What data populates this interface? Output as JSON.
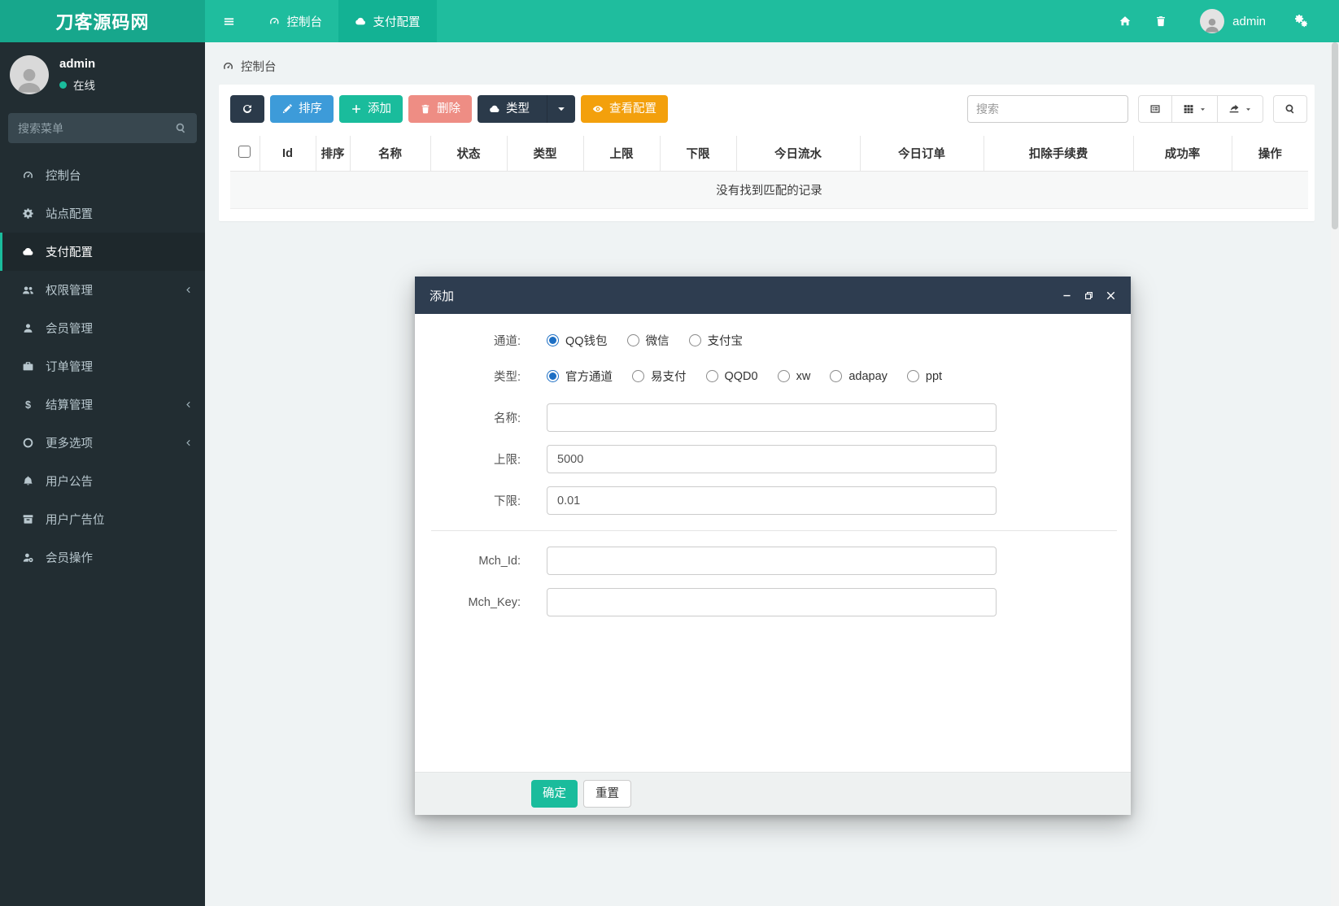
{
  "colors": {
    "teal": "#1fbd9e",
    "teal_logo": "#17a78c",
    "teal_active": "#13b294",
    "green": "#1abc9c",
    "blue": "#3d9bd9",
    "red": "#ee8d84",
    "orange": "#f3a00c",
    "dark": "#2b3a4a",
    "sidebar_bg": "#222d32",
    "sidebar_active_bg": "#1e282c",
    "radio_blue": "#1d6fc4",
    "page_bg": "#eff3f4"
  },
  "navbar": {
    "brand": "刀客源码网",
    "tab_dashboard": "控制台",
    "tab_payment": "支付配置",
    "username": "admin"
  },
  "sidebar": {
    "user_name": "admin",
    "user_status": "在线",
    "search_placeholder": "搜索菜单",
    "items": [
      {
        "label": "控制台",
        "icon": "gauge"
      },
      {
        "label": "站点配置",
        "icon": "gear"
      },
      {
        "label": "支付配置",
        "icon": "cloud",
        "active": true
      },
      {
        "label": "权限管理",
        "icon": "users",
        "chevron": true
      },
      {
        "label": "会员管理",
        "icon": "user"
      },
      {
        "label": "订单管理",
        "icon": "briefcase"
      },
      {
        "label": "结算管理",
        "icon": "dollar",
        "chevron": true
      },
      {
        "label": "更多选项",
        "icon": "circle-o",
        "chevron": true
      },
      {
        "label": "用户公告",
        "icon": "bell"
      },
      {
        "label": "用户广告位",
        "icon": "archive"
      },
      {
        "label": "会员操作",
        "icon": "user-badge"
      }
    ]
  },
  "breadcrumb": {
    "label": "控制台"
  },
  "toolbar": {
    "sort_label": "排序",
    "add_label": "添加",
    "delete_label": "删除",
    "type_label": "类型",
    "view_label": "查看配置",
    "search_placeholder": "搜索"
  },
  "table": {
    "headers": [
      "Id",
      "排序",
      "名称",
      "状态",
      "类型",
      "上限",
      "下限",
      "今日流水",
      "今日订单",
      "扣除手续费",
      "成功率",
      "操作"
    ],
    "empty_text": "没有找到匹配的记录"
  },
  "modal": {
    "title": "添加",
    "channel": {
      "label": "通道:",
      "options": [
        "QQ钱包",
        "微信",
        "支付宝"
      ],
      "selected": 0
    },
    "type": {
      "label": "类型:",
      "options": [
        "官方通道",
        "易支付",
        "QQD0",
        "xw",
        "adapay",
        "ppt"
      ],
      "selected": 0
    },
    "name": {
      "label": "名称:",
      "value": ""
    },
    "upper": {
      "label": "上限:",
      "value": "5000"
    },
    "lower": {
      "label": "下限:",
      "value": "0.01"
    },
    "mch_id": {
      "label": "Mch_Id:",
      "value": ""
    },
    "mch_key": {
      "label": "Mch_Key:",
      "value": ""
    },
    "confirm_label": "确定",
    "reset_label": "重置"
  }
}
